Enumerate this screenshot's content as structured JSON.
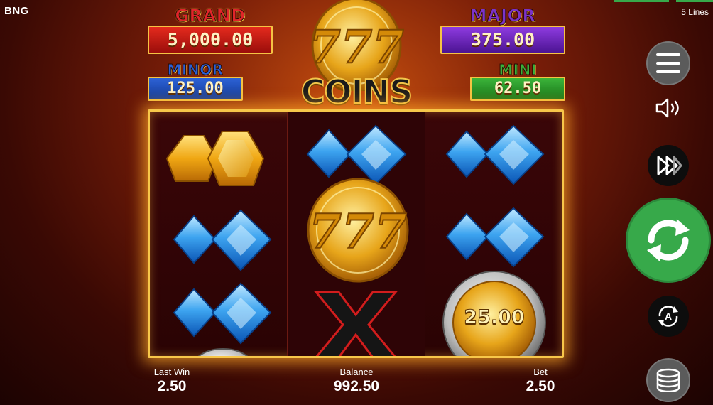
{
  "header": {
    "brand": "BNG",
    "lines": "5 Lines"
  },
  "jackpots": {
    "grand": {
      "title": "GRAND",
      "value": "5,000.00"
    },
    "major": {
      "title": "MAJOR",
      "value": "375.00"
    },
    "minor": {
      "title": "MINOR",
      "value": "125.00"
    },
    "mini": {
      "title": "MINI",
      "value": "62.50"
    }
  },
  "logo": {
    "text": "COINS"
  },
  "reels": [
    [
      "gold-gem",
      "blue-diamond",
      "blue-diamond"
    ],
    [
      "blue-diamond",
      "777-coin",
      "x-symbol"
    ],
    [
      "blue-diamond",
      "blue-diamond",
      "silver-coin"
    ]
  ],
  "coin_values": {
    "reel3_row3": "25.00"
  },
  "footer": {
    "last_win_label": "Last Win",
    "last_win_value": "2.50",
    "balance_label": "Balance",
    "balance_value": "992.50",
    "bet_label": "Bet",
    "bet_value": "2.50"
  },
  "controls": {
    "menu": "hamburger-menu-icon",
    "sound": "speaker-icon",
    "turbo": "fast-forward-icon",
    "spin": "refresh-spin-icon",
    "autoplay": "autoplay-a-icon",
    "stake": "coin-stack-icon"
  },
  "colors": {
    "frame": "#f7c74a",
    "spin": "#37a94a",
    "grand": "#e0262a",
    "major": "#7b33c9",
    "minor": "#2a5fd6",
    "mini": "#3ab03a"
  }
}
